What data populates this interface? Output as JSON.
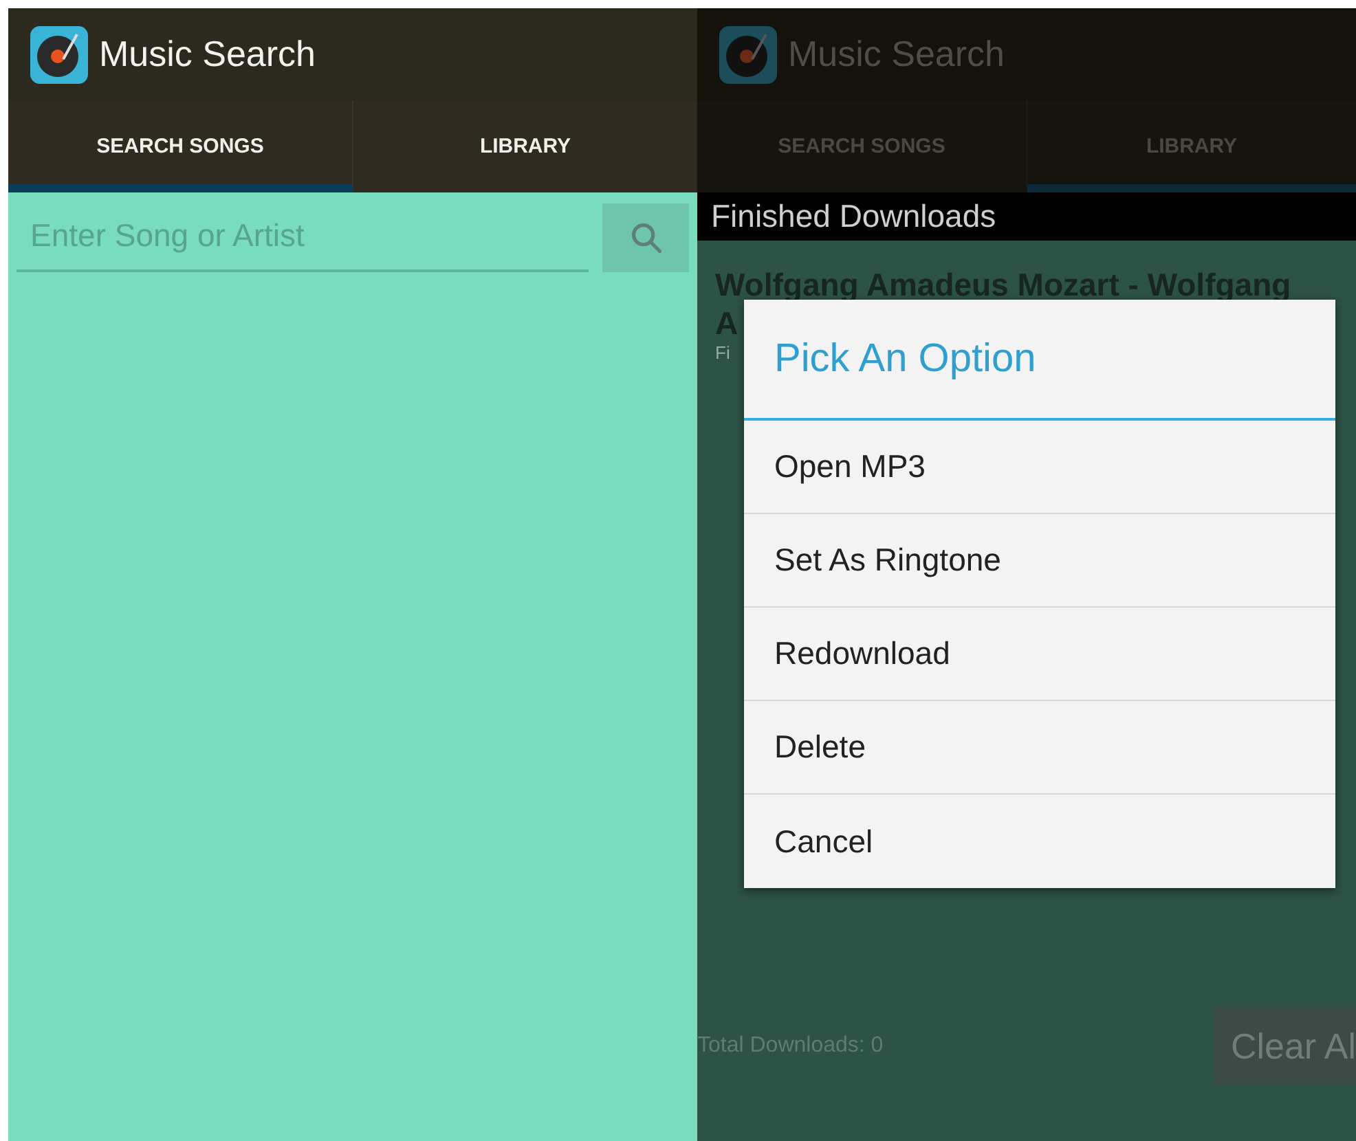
{
  "screens": [
    {
      "dimmed": false,
      "app_bar": {
        "title": "Music Search"
      },
      "tabs": [
        {
          "label": "SEARCH SONGS",
          "selected": true
        },
        {
          "label": "LIBRARY",
          "selected": false
        }
      ],
      "search": {
        "placeholder": "Enter Song or Artist"
      }
    },
    {
      "dimmed": true,
      "app_bar": {
        "title": "Music Search"
      },
      "tabs": [
        {
          "label": "SEARCH SONGS",
          "selected": false
        },
        {
          "label": "LIBRARY",
          "selected": true
        }
      ],
      "library": {
        "header": "Finished Downloads",
        "items": [
          {
            "title_lines": [
              "Wolfgang Amadeus Mozart - Wolfgang",
              "A"
            ],
            "subtitle": "Fi"
          }
        ],
        "total": "Total Downloads: 0",
        "clear_button": "Clear Al"
      },
      "dialog": {
        "title": "Pick An Option",
        "options": [
          "Open MP3",
          "Set As Ringtone",
          "Redownload",
          "Delete",
          "Cancel"
        ]
      }
    }
  ]
}
